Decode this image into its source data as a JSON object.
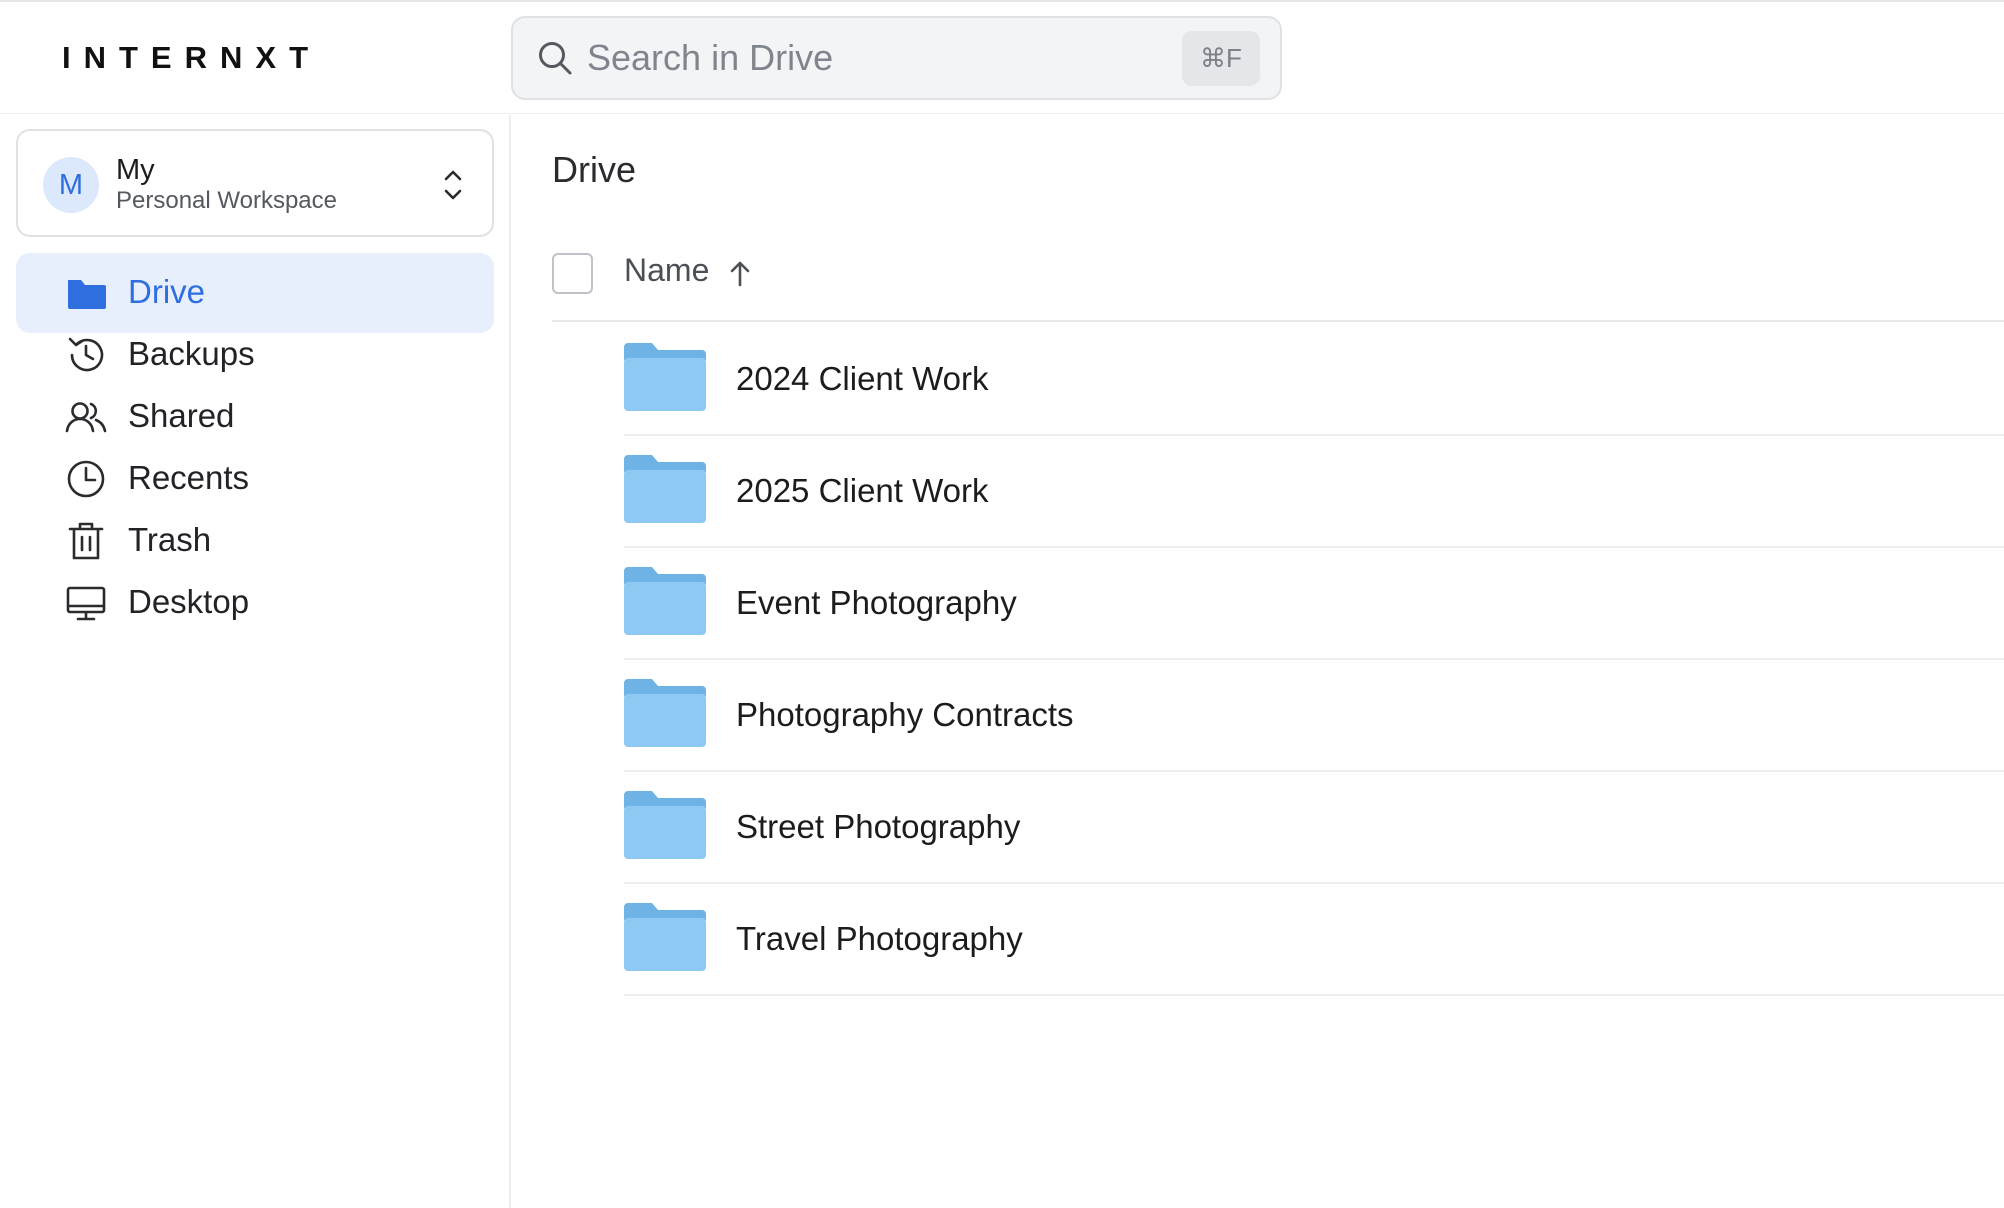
{
  "app": {
    "logo": "INTERNXT"
  },
  "search": {
    "placeholder": "Search in Drive",
    "value": "",
    "shortcut": "⌘F"
  },
  "workspace": {
    "avatar_initial": "M",
    "name": "My",
    "subtitle": "Personal Workspace"
  },
  "sidebar": {
    "items": [
      {
        "label": "Drive",
        "icon": "folder-icon",
        "active": true
      },
      {
        "label": "Backups",
        "icon": "history-icon",
        "active": false
      },
      {
        "label": "Shared",
        "icon": "users-icon",
        "active": false
      },
      {
        "label": "Recents",
        "icon": "clock-icon",
        "active": false
      },
      {
        "label": "Trash",
        "icon": "trash-icon",
        "active": false
      },
      {
        "label": "Desktop",
        "icon": "desktop-icon",
        "active": false
      }
    ]
  },
  "main": {
    "title": "Drive",
    "columns": {
      "name": "Name",
      "sort": "ascending"
    },
    "rows": [
      {
        "name": "2024 Client Work",
        "type": "folder"
      },
      {
        "name": "2025 Client Work",
        "type": "folder"
      },
      {
        "name": "Event Photography",
        "type": "folder"
      },
      {
        "name": "Photography Contracts",
        "type": "folder"
      },
      {
        "name": "Street Photography",
        "type": "folder"
      },
      {
        "name": "Travel Photography",
        "type": "folder"
      }
    ]
  },
  "colors": {
    "accent": "#2f6ede",
    "active_bg": "#e7eefc",
    "folder": "#8dc9f2",
    "folder_tab": "#6fb3e6"
  }
}
